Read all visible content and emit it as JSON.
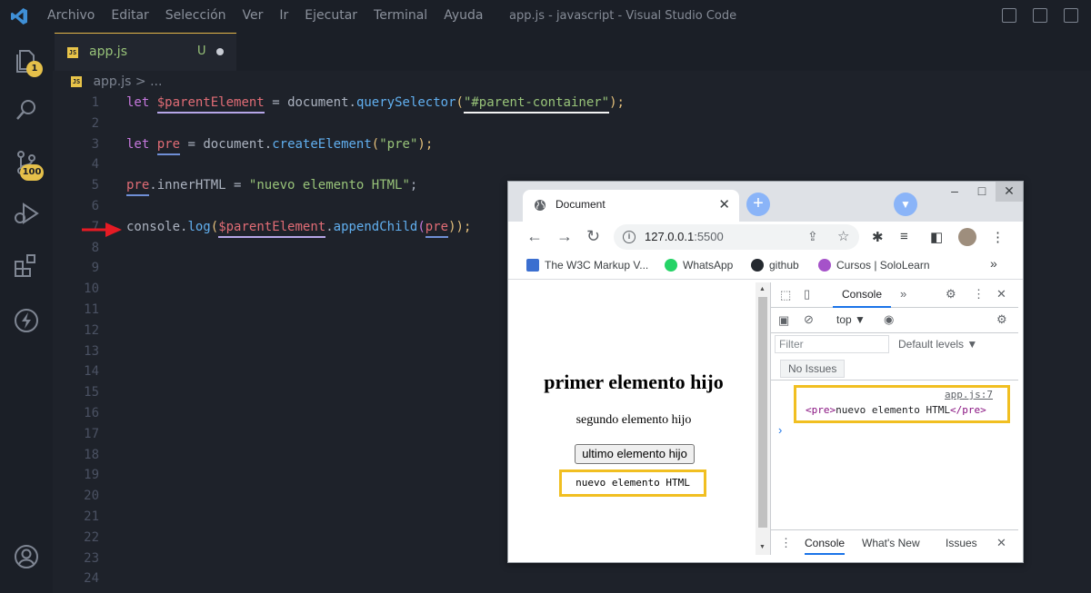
{
  "titlebar": {
    "menu": [
      "Archivo",
      "Editar",
      "Selección",
      "Ver",
      "Ir",
      "Ejecutar",
      "Terminal",
      "Ayuda"
    ],
    "title": "app.js - javascript - Visual Studio Code"
  },
  "activity_bar": {
    "explorer_badge": "1",
    "source_control_badge": "100",
    "items": [
      "files-icon",
      "search-icon",
      "source-control-icon",
      "run-debug-icon",
      "extensions-icon",
      "bolt-icon",
      "account-icon"
    ]
  },
  "editor": {
    "tab": {
      "label": "app.js",
      "status": "U",
      "badge": "JS"
    },
    "breadcrumb": {
      "file": "app.js",
      "separator": ">",
      "more": "..."
    },
    "line_numbers": [
      "1",
      "2",
      "3",
      "4",
      "5",
      "6",
      "7",
      "8",
      "9",
      "10",
      "11",
      "12",
      "13",
      "14",
      "15",
      "16",
      "17",
      "18",
      "19",
      "20",
      "21",
      "22",
      "23",
      "24"
    ],
    "code": {
      "l1": {
        "kw": "let",
        "var": "$parentElement",
        "eq": "=",
        "obj": "document",
        "dot": ".",
        "fn": "querySelector",
        "p1": "(",
        "str": "\"#parent-container\"",
        "p2": ");"
      },
      "l3": {
        "kw": "let",
        "var": "pre",
        "eq": "=",
        "obj": "document",
        "dot": ".",
        "fn": "createElement",
        "p1": "(",
        "str": "\"pre\"",
        "p2": ");"
      },
      "l5": {
        "var": "pre",
        "prop": ".innerHTML",
        "eq": "=",
        "str": "\"nuevo elemento HTML\"",
        "end": ";"
      },
      "l7": {
        "obj": "console",
        "dot": ".",
        "fn": "log",
        "p1": "(",
        "var": "$parentElement",
        "dot2": ".",
        "fn2": "appendChild",
        "p2": "(",
        "arg": "pre",
        "p3": "));"
      }
    }
  },
  "browser": {
    "tab_title": "Document",
    "tab_close": "✕",
    "new_tab": "+",
    "url_host": "127.0.0.1",
    "url_port": ":5500",
    "bookmarks": [
      "The W3C Markup V...",
      "WhatsApp",
      "github",
      "Cursos | SoloLearn"
    ],
    "bookmarks_more": "»",
    "page": {
      "heading": "primer elemento hijo",
      "paragraph": "segundo elemento hijo",
      "button": "ultimo elemento hijo",
      "pre": "nuevo elemento HTML"
    },
    "devtools": {
      "active_tab": "Console",
      "more_tabs": "»",
      "context": "top",
      "filter_placeholder": "Filter",
      "levels": "Default levels ▼",
      "no_issues": "No Issues",
      "log_source": "app.js:7",
      "log_open_tag": "<pre>",
      "log_text": "nuevo elemento HTML",
      "log_close_tag": "</pre>",
      "prompt": "›",
      "drawer_tabs": [
        "Console",
        "What's New",
        "Issues"
      ]
    }
  },
  "colors": {
    "editor_bg": "#1e222a",
    "accent_yellow": "#f1bf21",
    "keyword": "#c678dd",
    "function": "#61afef",
    "string": "#98c379",
    "arrow": "#e51b24"
  }
}
